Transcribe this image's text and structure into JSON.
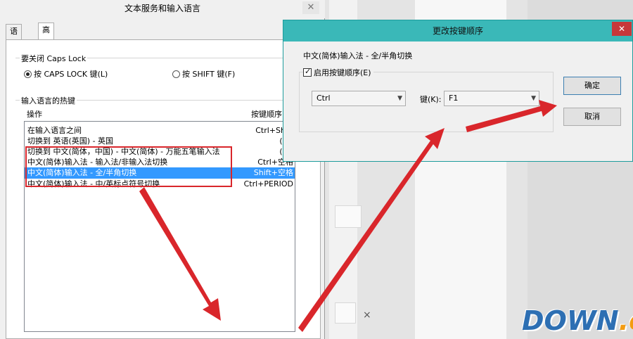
{
  "left_dialog": {
    "title": "文本服务和输入语言",
    "close_glyph": "✕",
    "tabs": [
      {
        "label": "语言栏",
        "active": false
      },
      {
        "label": "高级键设置",
        "active": true
      }
    ],
    "caps_group_label": "要关闭 Caps Lock",
    "caps_options": [
      {
        "label": "按 CAPS LOCK 键(L)",
        "selected": true
      },
      {
        "label": "按 SHIFT 键(F)",
        "selected": false
      }
    ],
    "hotkey_group_label": "输入语言的热键",
    "list_headers": {
      "action": "操作",
      "key_sequence": "按键顺序"
    },
    "hotkey_rows": [
      {
        "action": "在输入语言之间",
        "keys": "Ctrl+Shift",
        "selected": false
      },
      {
        "action": "切换到 英语(英国) - 英国",
        "keys": "(无)",
        "selected": false
      },
      {
        "action": "切换到 中文(简体，中国) - 中文(简体) - 万能五笔输入法",
        "keys": "(无)",
        "selected": false
      },
      {
        "action": "中文(简体)输入法 - 输入法/非输入法切换",
        "keys": "Ctrl+空格",
        "selected": false
      },
      {
        "action": "中文(简体)输入法 - 全/半角切换",
        "keys": "Shift+空格",
        "selected": true
      },
      {
        "action": "中文(简体)输入法 - 中/英标点符号切换",
        "keys": "Ctrl+PERIOD",
        "selected": false
      }
    ]
  },
  "right_dialog": {
    "title": "更改按键顺序",
    "close_glyph": "✕",
    "description": "中文(简体)输入法 - 全/半角切换",
    "enable_checkbox": {
      "label": "启用按键顺序(E)",
      "checked": true
    },
    "modifier_value": "Ctrl",
    "key_label": "键(K):",
    "key_value": "F1",
    "ok_label": "确定",
    "cancel_label": "取消"
  },
  "background": {
    "close_glyph": "×"
  },
  "watermark": {
    "main": "DOWN",
    "suffix": ".cc"
  },
  "colors": {
    "selection": "#3399ff",
    "annotation_red": "#d9262b",
    "title_bar_teal": "#3ab8b8",
    "watermark_blue": "#2d6fb3"
  }
}
